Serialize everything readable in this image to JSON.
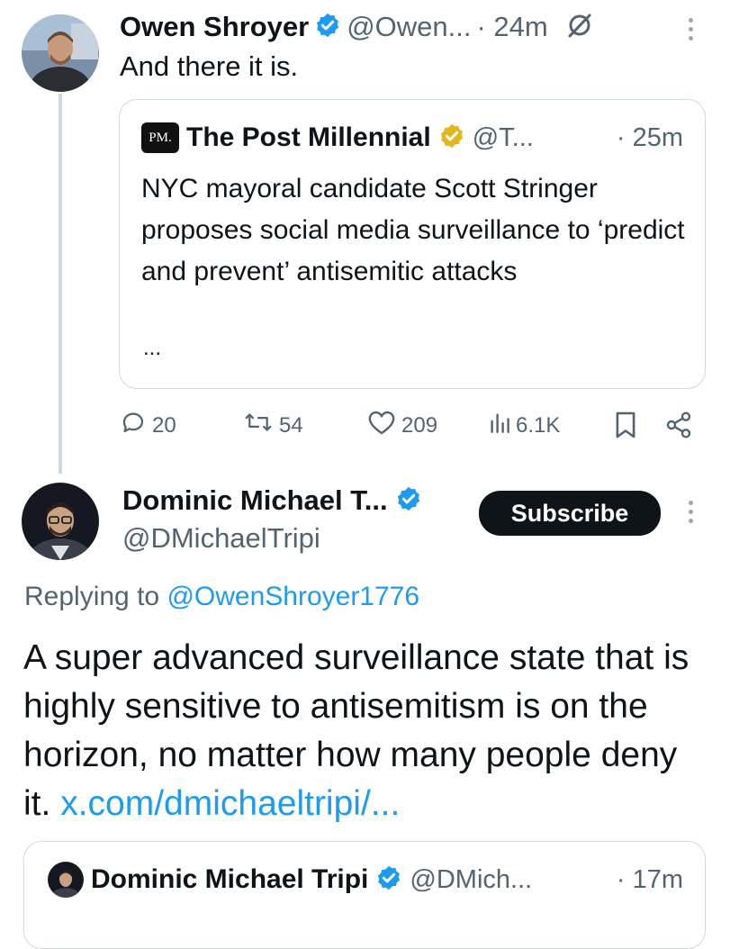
{
  "tweet1": {
    "author_name": "Owen Shroyer",
    "handle": "@Owen...",
    "time": "· 24m",
    "text": "And there it is.",
    "quote": {
      "logo_text": "PM.",
      "author_name": "The Post Millennial",
      "handle": "@T...",
      "time": "· 25m",
      "text": "NYC mayoral candidate Scott Stringer proposes social media surveillance to ‘predict and prevent’ antisemitic attacks",
      "ellipsis": "..."
    },
    "actions": {
      "replies": "20",
      "reposts": "54",
      "likes": "209",
      "views": "6.1K"
    }
  },
  "tweet2": {
    "author_name": "Dominic Michael T...",
    "handle": "@DMichaelTripi",
    "subscribe_label": "Subscribe",
    "replying_prefix": "Replying to",
    "replying_handle": "@OwenShroyer1776",
    "text": "A super advanced surveillance state that is highly sensitive to antisemitism is on the horizon, no matter how many people deny it.",
    "link": "x.com/dmichaeltripi/...",
    "quote": {
      "author_name": "Dominic Michael Tripi",
      "handle": "@DMich...",
      "time": "· 17m"
    }
  },
  "colors": {
    "verified_blue": "#1d9bf0",
    "verified_gold": "#e2b719",
    "link": "#1d9bf0",
    "muted": "#536471",
    "button_bg": "#0f1419"
  }
}
